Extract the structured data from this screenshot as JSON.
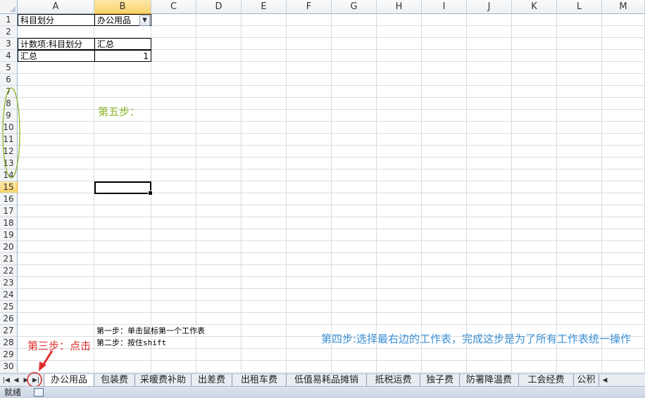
{
  "columns": [
    "A",
    "B",
    "C",
    "D",
    "E",
    "F",
    "G",
    "H",
    "I",
    "J",
    "K",
    "L",
    "M"
  ],
  "rows": [
    "1",
    "2",
    "3",
    "4",
    "5",
    "6",
    "7",
    "8",
    "9",
    "10",
    "11",
    "12",
    "13",
    "14",
    "15",
    "16",
    "17",
    "18",
    "19",
    "20",
    "21",
    "22",
    "23",
    "24",
    "25",
    "26",
    "27",
    "28",
    "29",
    "30"
  ],
  "cells": {
    "a1": "科目划分",
    "b1": "办公用品",
    "a3": "计数项:科目划分",
    "b3": "汇总",
    "a4": "汇总",
    "b4": "1",
    "b27": "第一步：单击鼠标第一个工作表",
    "b28": "第二步：按住shift"
  },
  "filter_icon": "filter-dropdown-icon",
  "annotations": {
    "step5": "第五步：",
    "step3": "第三步：点击",
    "step4": "第四步:选择最右边的工作表，完成这步是为了所有工作表统一操作"
  },
  "sheet_tabs": [
    "办公用品",
    "包装费",
    "采暖费补助",
    "出差费",
    "出租车费",
    "低值易耗品摊销",
    "抵税运费",
    "独子费",
    "防署降温费",
    "工会经费",
    "公积"
  ],
  "status": {
    "ready": "就绪"
  },
  "colors": {
    "step5": "#8db52a",
    "step3": "#e03030",
    "step4": "#3b8fd4",
    "selected_header": "#f9d36b"
  }
}
